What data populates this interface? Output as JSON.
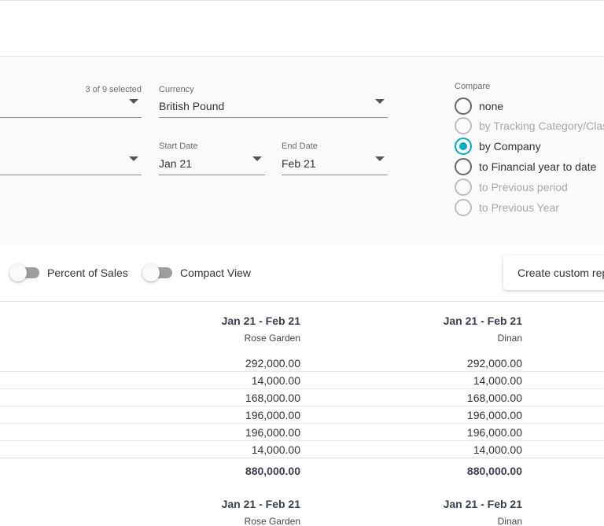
{
  "filters": {
    "companies_count": "3 of 9 selected",
    "currency": {
      "label": "Currency",
      "value": "British Pound"
    },
    "start_date": {
      "label": "Start Date",
      "value": "Jan 21"
    },
    "end_date": {
      "label": "End Date",
      "value": "Feb 21"
    }
  },
  "compare": {
    "label": "Compare",
    "options": [
      {
        "label": "none",
        "state": "unchecked"
      },
      {
        "label": "by Tracking Category/Class",
        "state": "disabled"
      },
      {
        "label": "by Company",
        "state": "checked"
      },
      {
        "label": "to Financial year to date",
        "state": "unchecked"
      },
      {
        "label": "to Previous period",
        "state": "disabled"
      },
      {
        "label": "to Previous Year",
        "state": "disabled"
      }
    ]
  },
  "toggles": {
    "percent_of_sales": "Percent of Sales",
    "compact_view": "Compact View"
  },
  "actions": {
    "create_custom": "Create custom report"
  },
  "table": {
    "columns": [
      {
        "period": "Jan 21 - Feb 21",
        "company": "Rose Garden"
      },
      {
        "period": "Jan 21 - Feb 21",
        "company": "Dinan"
      }
    ],
    "rows": [
      [
        "292,000.00",
        "292,000.00"
      ],
      [
        "14,000.00",
        "14,000.00"
      ],
      [
        "168,000.00",
        "168,000.00"
      ],
      [
        "196,000.00",
        "196,000.00"
      ],
      [
        "196,000.00",
        "196,000.00"
      ],
      [
        "14,000.00",
        "14,000.00"
      ]
    ],
    "totals": [
      "880,000.00",
      "880,000.00"
    ],
    "columns_2": [
      {
        "period": "Jan 21 - Feb 21",
        "company": "Rose Garden"
      },
      {
        "period": "Jan 21 - Feb 21",
        "company": "Dinan"
      }
    ]
  },
  "colors": {
    "accent": "#00acc1",
    "heading": "#3a3f51"
  }
}
